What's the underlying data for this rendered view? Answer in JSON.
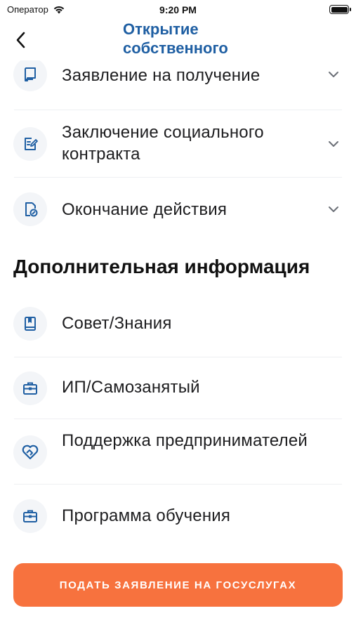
{
  "status_bar": {
    "carrier": "Оператор",
    "time": "9:20 PM"
  },
  "nav": {
    "title": "Открытие собственного"
  },
  "steps": [
    {
      "label": "Заявление на получение",
      "icon": "document-icon"
    },
    {
      "label": "Заключение социального контракта",
      "icon": "edit-document-icon"
    },
    {
      "label": "Окончание действия",
      "icon": "file-clock-icon"
    }
  ],
  "additional": {
    "title": "Дополнительная информация",
    "items": [
      {
        "label": "Совет/Знания",
        "icon": "book-icon"
      },
      {
        "label": "ИП/Самозанятый",
        "icon": "briefcase-icon"
      },
      {
        "label": "Поддержка предпринимателей",
        "icon": "heart-handshake-icon"
      },
      {
        "label": "Программа обучения",
        "icon": "briefcase-icon"
      }
    ]
  },
  "cta": {
    "label": "ПОДАТЬ ЗАЯВЛЕНИЕ НА ГОСУСЛУГАХ"
  },
  "colors": {
    "accent": "#1f5fa3",
    "cta": "#f7723e",
    "icon_bg": "#f3f5f8"
  }
}
